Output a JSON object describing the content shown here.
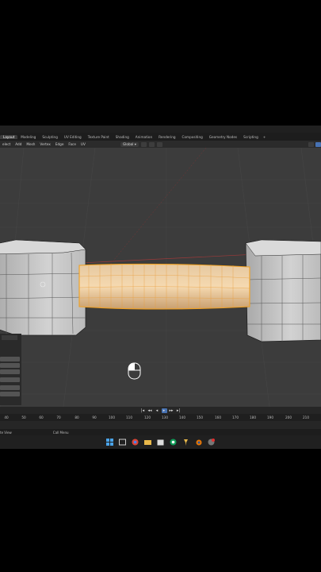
{
  "workspace_tabs": [
    "Layout",
    "Modeling",
    "Sculpting",
    "UV Editing",
    "Texture Paint",
    "Shading",
    "Animation",
    "Rendering",
    "Compositing",
    "Geometry Nodes",
    "Scripting"
  ],
  "header_menu": [
    "elect",
    "Add",
    "Mesh",
    "Vertex",
    "Edge",
    "Face",
    "UV"
  ],
  "transform_orientation": "Global",
  "timeline": {
    "frame_labels": [
      "40",
      "50",
      "60",
      "70",
      "80",
      "90",
      "100",
      "110",
      "120",
      "130",
      "140",
      "150",
      "160",
      "170",
      "180",
      "190",
      "200",
      "210"
    ]
  },
  "statusbar": {
    "left": "te View",
    "center": "Call Menu"
  },
  "colors": {
    "accent": "#4772b3",
    "selection": "#f0a020",
    "viewport": "#3c3c3c"
  },
  "icons": {
    "mouse": "mouse-icon",
    "taskbar": [
      "windows-start-icon",
      "search-icon",
      "chrome-icon",
      "folder-icon",
      "store-icon",
      "chrome-icon",
      "pin-icon",
      "blender-icon",
      "recorder-icon"
    ]
  }
}
